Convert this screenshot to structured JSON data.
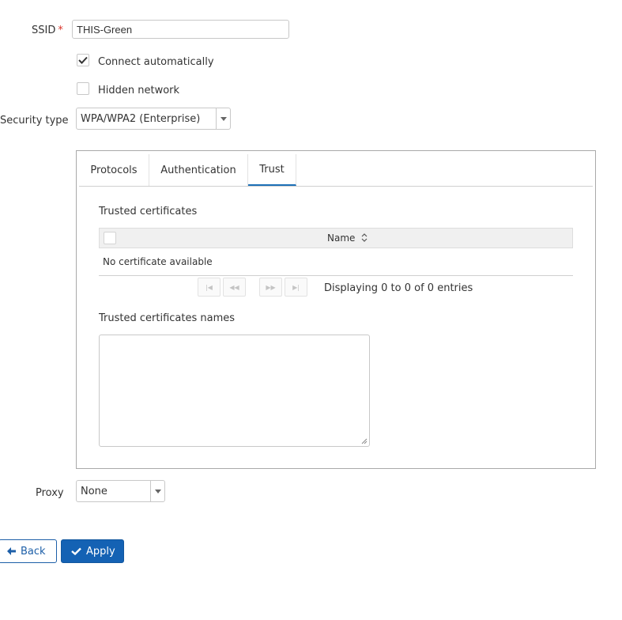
{
  "form": {
    "ssid_label": "SSID",
    "required_marker": "*",
    "ssid_value": "THIS-Green",
    "connect_auto_label": "Connect automatically",
    "connect_auto_checked": true,
    "hidden_network_label": "Hidden network",
    "hidden_network_checked": false,
    "security_type_label": "Security type",
    "security_type_value": "WPA/WPA2 (Enterprise)",
    "proxy_label": "Proxy",
    "proxy_value": "None"
  },
  "tabs": [
    {
      "label": "Protocols",
      "active": false
    },
    {
      "label": "Authentication",
      "active": false
    },
    {
      "label": "Trust",
      "active": true
    }
  ],
  "trust": {
    "trusted_certificates_label": "Trusted certificates",
    "grid": {
      "column_name": "Name",
      "empty_message": "No certificate available",
      "paging_text": "Displaying 0 to 0 of 0 entries"
    },
    "trusted_names_label": "Trusted certificates names",
    "trusted_names_value": ""
  },
  "buttons": {
    "back_label": "Back",
    "apply_label": "Apply"
  },
  "colors": {
    "accent": "#1d70b7",
    "primary_button": "#1462b4",
    "required": "#d9342b"
  }
}
